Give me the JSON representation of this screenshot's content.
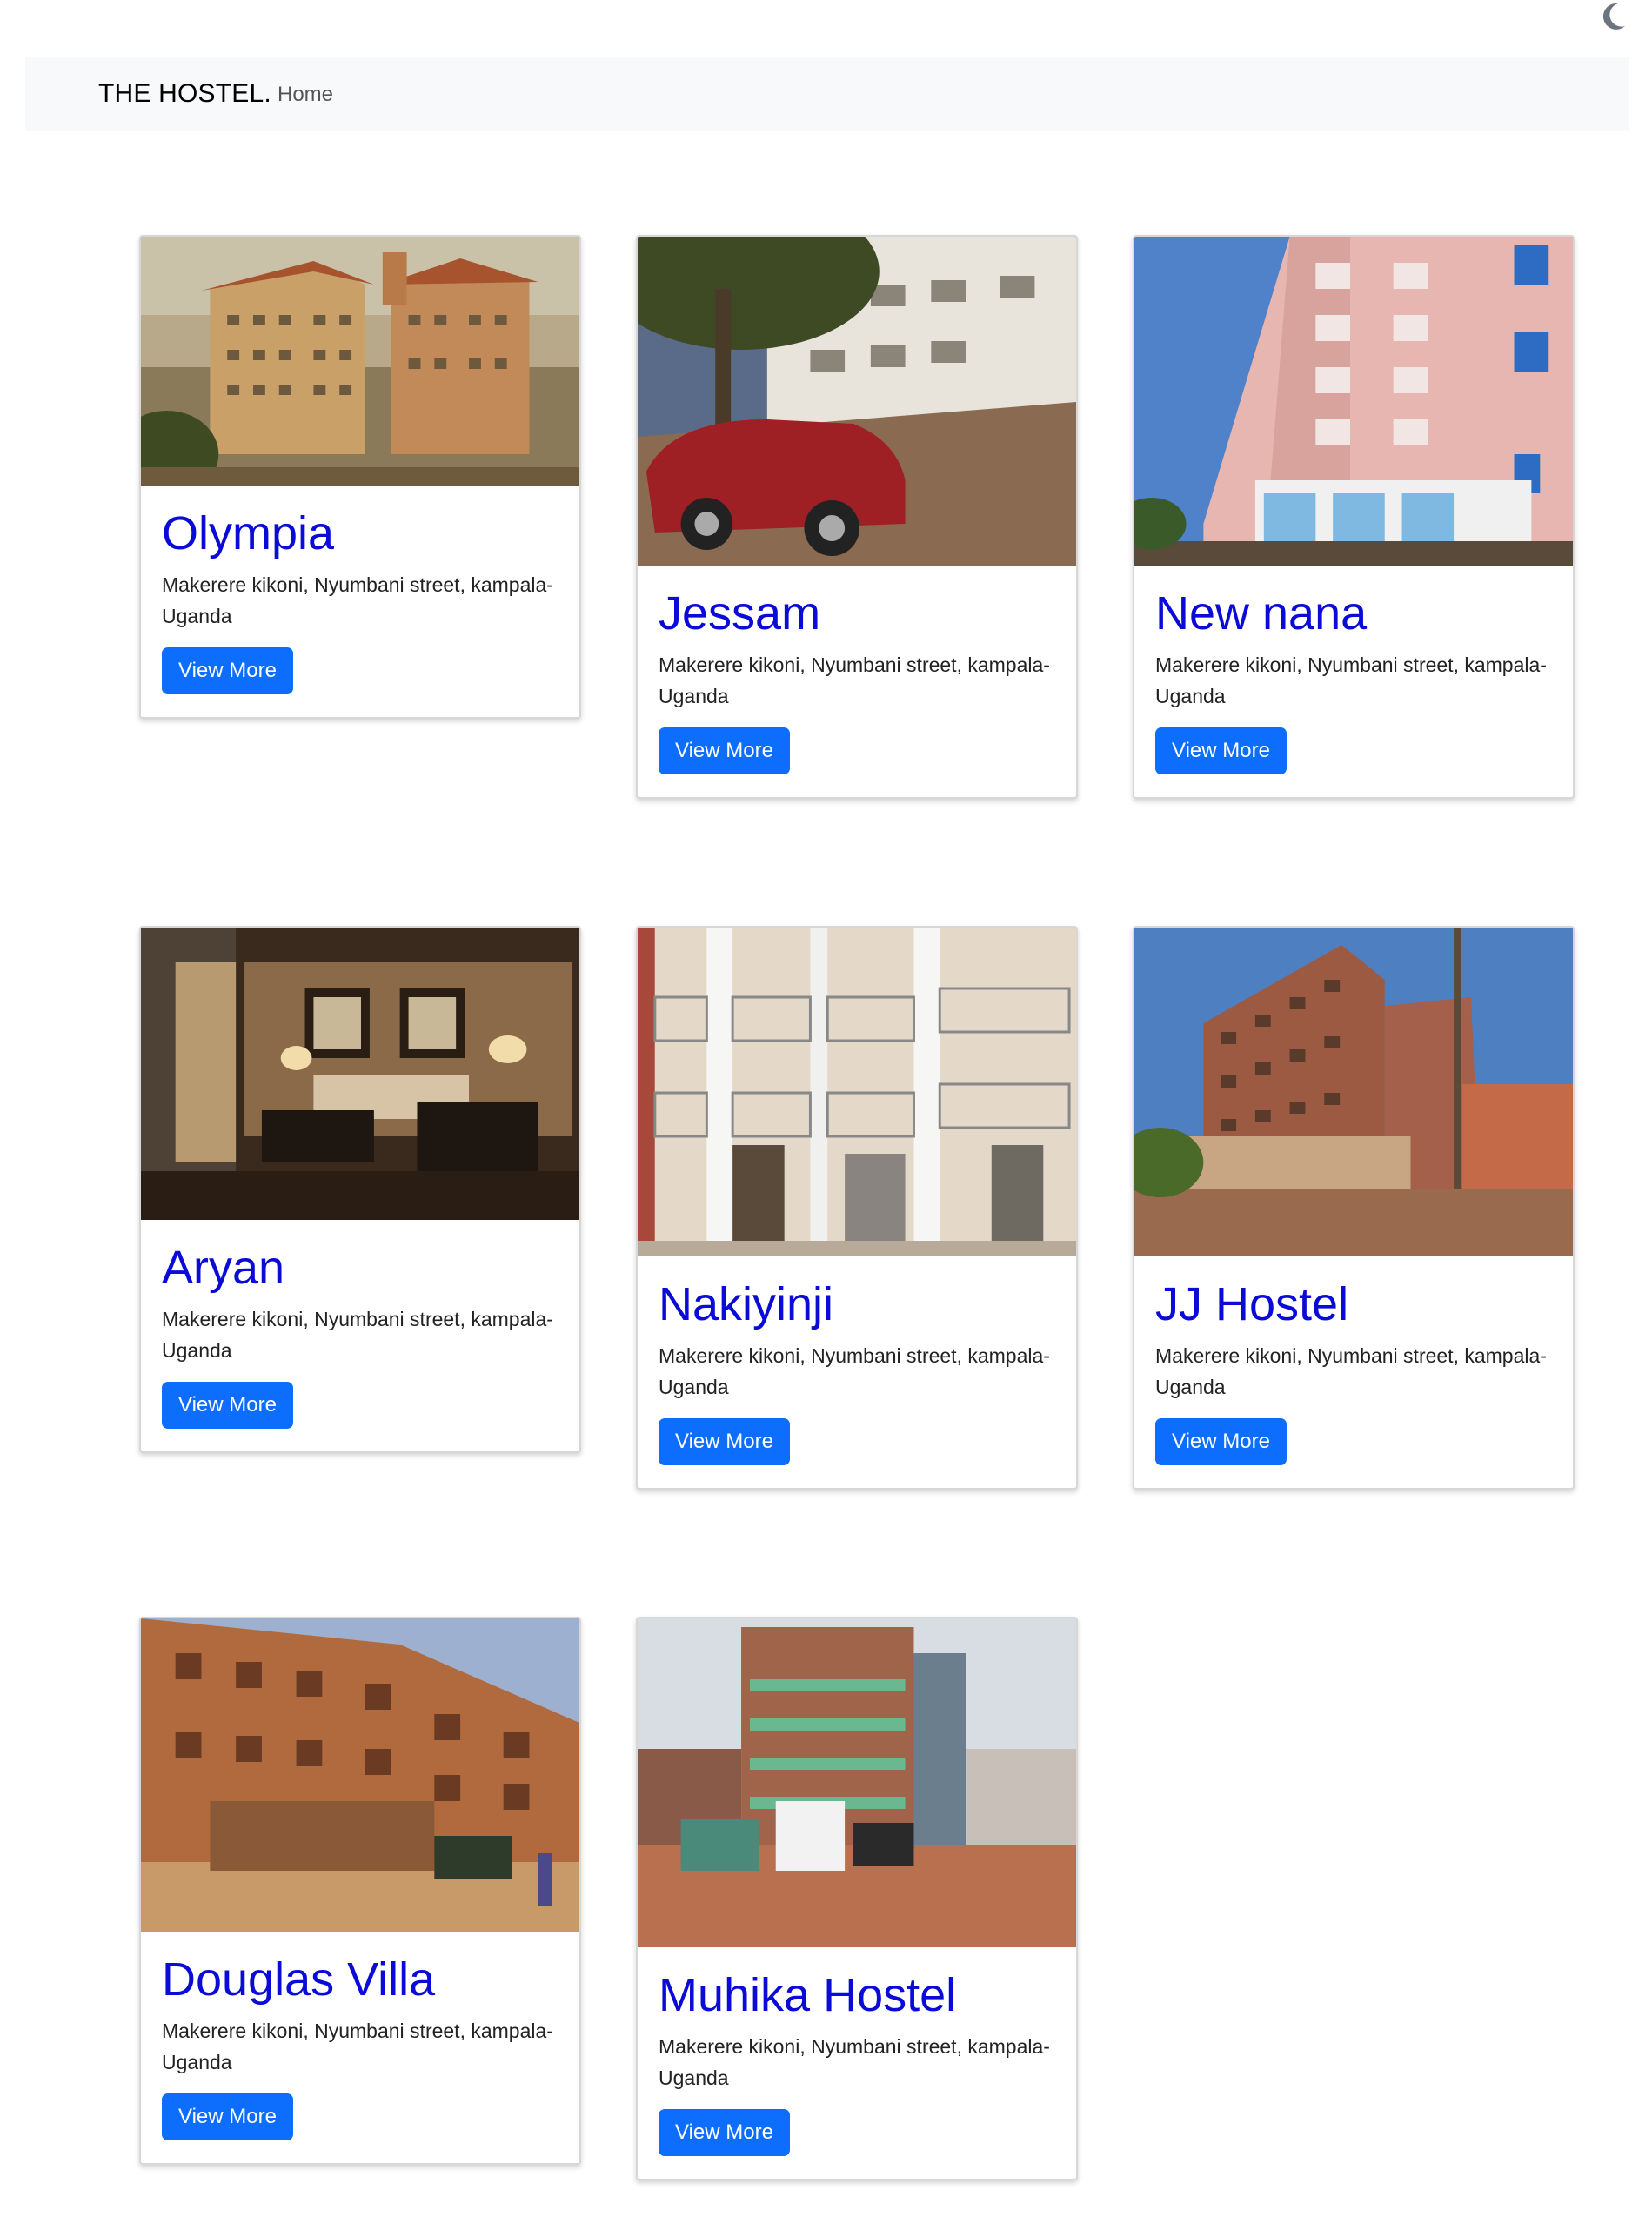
{
  "brand": "THE HOSTEL.",
  "nav": {
    "home": "Home"
  },
  "theme_toggle_icon": "moon-icon",
  "colors": {
    "title": "#0b0bd8",
    "button": "#0d6efd",
    "navbar_bg": "#f8f9fa"
  },
  "hostels": [
    {
      "name": "Olympia",
      "address": "Makerere kikoni, Nyumbani street, kampala-Uganda",
      "button": "View More"
    },
    {
      "name": "Jessam",
      "address": "Makerere kikoni, Nyumbani street, kampala-Uganda",
      "button": "View More"
    },
    {
      "name": "New nana",
      "address": "Makerere kikoni, Nyumbani street, kampala-Uganda",
      "button": "View More"
    },
    {
      "name": "Aryan",
      "address": "Makerere kikoni, Nyumbani street, kampala-Uganda",
      "button": "View More"
    },
    {
      "name": "Nakiyinji",
      "address": "Makerere kikoni, Nyumbani street, kampala-Uganda",
      "button": "View More"
    },
    {
      "name": "JJ Hostel",
      "address": "Makerere kikoni, Nyumbani street, kampala-Uganda",
      "button": "View More"
    },
    {
      "name": "Douglas Villa",
      "address": "Makerere kikoni, Nyumbani street, kampala-Uganda",
      "button": "View More"
    },
    {
      "name": "Muhika Hostel",
      "address": "Makerere kikoni, Nyumbani street, kampala-Uganda",
      "button": "View More"
    }
  ]
}
